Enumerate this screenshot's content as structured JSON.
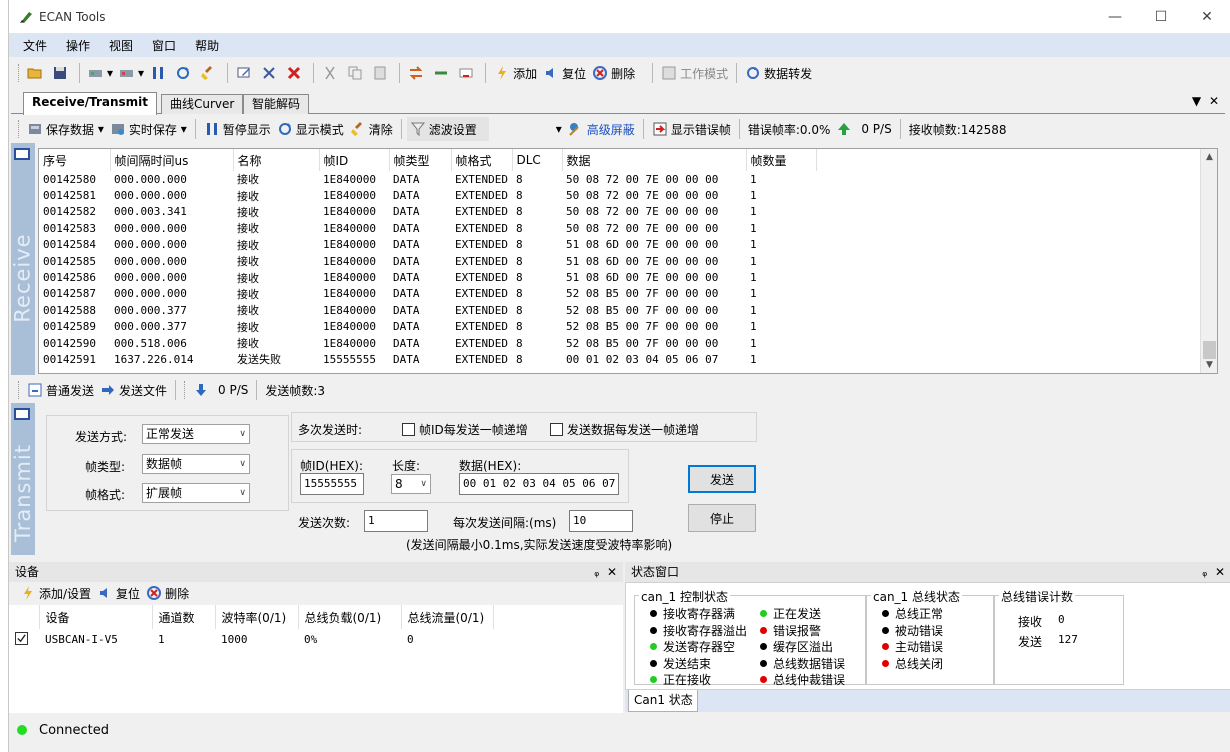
{
  "window": {
    "title": "ECAN Tools",
    "minimize": "—",
    "maximize": "☐",
    "close": "✕"
  },
  "menu": [
    "文件",
    "操作",
    "视图",
    "窗口",
    "帮助"
  ],
  "toolbar1": {
    "add": "添加",
    "reset": "复位",
    "delete": "删除",
    "work_mode": "工作模式",
    "data_forward": "数据转发"
  },
  "tabs": {
    "receive_transmit": "Receive/Transmit",
    "curve": "曲线Curver",
    "decode": "智能解码",
    "pin": "▼",
    "close": "✕"
  },
  "toolbar2": {
    "save_data": "保存数据",
    "realtime_save": "实时保存",
    "pause_display": "暂停显示",
    "display_mode": "显示模式",
    "clear": "清除",
    "filter_settings": "滤波设置",
    "advanced_mask": "高级屏蔽",
    "show_error_frames": "显示错误帧",
    "error_rate": "错误帧率:0.0%",
    "rate": "0 P/S",
    "received_frames": "接收帧数:142588"
  },
  "receive": {
    "side_label": "Receive",
    "columns": [
      "序号",
      "帧间隔时间us",
      "名称",
      "帧ID",
      "帧类型",
      "帧格式",
      "DLC",
      "数据",
      "帧数量"
    ],
    "rows": [
      [
        "00142580",
        "000.000.000",
        "接收",
        "1E840000",
        "DATA",
        "EXTENDED",
        "8",
        "50 08 72 00 7E 00 00 00",
        "1"
      ],
      [
        "00142581",
        "000.000.000",
        "接收",
        "1E840000",
        "DATA",
        "EXTENDED",
        "8",
        "50 08 72 00 7E 00 00 00",
        "1"
      ],
      [
        "00142582",
        "000.003.341",
        "接收",
        "1E840000",
        "DATA",
        "EXTENDED",
        "8",
        "50 08 72 00 7E 00 00 00",
        "1"
      ],
      [
        "00142583",
        "000.000.000",
        "接收",
        "1E840000",
        "DATA",
        "EXTENDED",
        "8",
        "50 08 72 00 7E 00 00 00",
        "1"
      ],
      [
        "00142584",
        "000.000.000",
        "接收",
        "1E840000",
        "DATA",
        "EXTENDED",
        "8",
        "51 08 6D 00 7E 00 00 00",
        "1"
      ],
      [
        "00142585",
        "000.000.000",
        "接收",
        "1E840000",
        "DATA",
        "EXTENDED",
        "8",
        "51 08 6D 00 7E 00 00 00",
        "1"
      ],
      [
        "00142586",
        "000.000.000",
        "接收",
        "1E840000",
        "DATA",
        "EXTENDED",
        "8",
        "51 08 6D 00 7E 00 00 00",
        "1"
      ],
      [
        "00142587",
        "000.000.000",
        "接收",
        "1E840000",
        "DATA",
        "EXTENDED",
        "8",
        "52 08 B5 00 7F 00 00 00",
        "1"
      ],
      [
        "00142588",
        "000.000.377",
        "接收",
        "1E840000",
        "DATA",
        "EXTENDED",
        "8",
        "52 08 B5 00 7F 00 00 00",
        "1"
      ],
      [
        "00142589",
        "000.000.377",
        "接收",
        "1E840000",
        "DATA",
        "EXTENDED",
        "8",
        "52 08 B5 00 7F 00 00 00",
        "1"
      ],
      [
        "00142590",
        "000.518.006",
        "接收",
        "1E840000",
        "DATA",
        "EXTENDED",
        "8",
        "52 08 B5 00 7F 00 00 00",
        "1"
      ],
      [
        "00142591",
        "1637.226.014",
        "发送失败",
        "15555555",
        "DATA",
        "EXTENDED",
        "8",
        "00 01 02 03 04 05 06 07",
        "1"
      ]
    ]
  },
  "toolbar3": {
    "normal_send": "普通发送",
    "send_file": "发送文件",
    "rate": "0 P/S",
    "sent_frames": "发送帧数:3"
  },
  "transmit": {
    "side_label": "Transmit",
    "send_mode_label": "发送方式:",
    "send_mode": "正常发送",
    "frame_type_label": "帧类型:",
    "frame_type": "数据帧",
    "frame_format_label": "帧格式:",
    "frame_format": "扩展帧",
    "multi_label": "多次发送时:",
    "id_increment": "帧ID每发送一帧递增",
    "data_increment": "发送数据每发送一帧递增",
    "frame_id_label": "帧ID(HEX):",
    "frame_id": "15555555",
    "length_label": "长度:",
    "length": "8",
    "data_label": "数据(HEX):",
    "data": "00 01 02 03 04 05 06 07",
    "send_button": "发送",
    "stop_button": "停止",
    "count_label": "发送次数:",
    "count": "1",
    "interval_label": "每次发送间隔:(ms)",
    "interval": "10",
    "note": "(发送间隔最小0.1ms,实际发送速度受波特率影响)"
  },
  "device": {
    "title": "设备",
    "pin": "ᵩ",
    "close": "✕",
    "add_settings": "添加/设置",
    "reset": "复位",
    "delete": "删除",
    "columns": [
      "设备",
      "通道数",
      "波特率(0/1)",
      "总线负载(0/1)",
      "总线流量(0/1)"
    ],
    "rows": [
      [
        "USBCAN-I-V5",
        "1",
        "1000",
        "0%",
        "0"
      ]
    ]
  },
  "status": {
    "title": "状态窗口",
    "pin": "ᵩ",
    "close": "✕",
    "ctrl_title": "can_1 控制状态",
    "ctrl_left": [
      {
        "label": "接收寄存器满",
        "color": "#000000"
      },
      {
        "label": "接收寄存器溢出",
        "color": "#000000"
      },
      {
        "label": "发送寄存器空",
        "color": "#22cc22"
      },
      {
        "label": "发送结束",
        "color": "#000000"
      },
      {
        "label": "正在接收",
        "color": "#22cc22"
      }
    ],
    "ctrl_right": [
      {
        "label": "正在发送",
        "color": "#22cc22"
      },
      {
        "label": "错误报警",
        "color": "#e00000"
      },
      {
        "label": "缓存区溢出",
        "color": "#000000"
      },
      {
        "label": "总线数据错误",
        "color": "#000000"
      },
      {
        "label": "总线仲裁错误",
        "color": "#e00000"
      }
    ],
    "bus_title": "can_1 总线状态",
    "bus_items": [
      {
        "label": "总线正常",
        "color": "#000000"
      },
      {
        "label": "被动错误",
        "color": "#000000"
      },
      {
        "label": "主动错误",
        "color": "#e00000"
      },
      {
        "label": "总线关闭",
        "color": "#e00000"
      }
    ],
    "err_title": "总线错误计数",
    "rx_label": "接收",
    "rx_count": "0",
    "tx_label": "发送",
    "tx_count": "127",
    "tab": "Can1 状态"
  },
  "statusbar": {
    "connection": "Connected",
    "color": "#22dd22"
  }
}
